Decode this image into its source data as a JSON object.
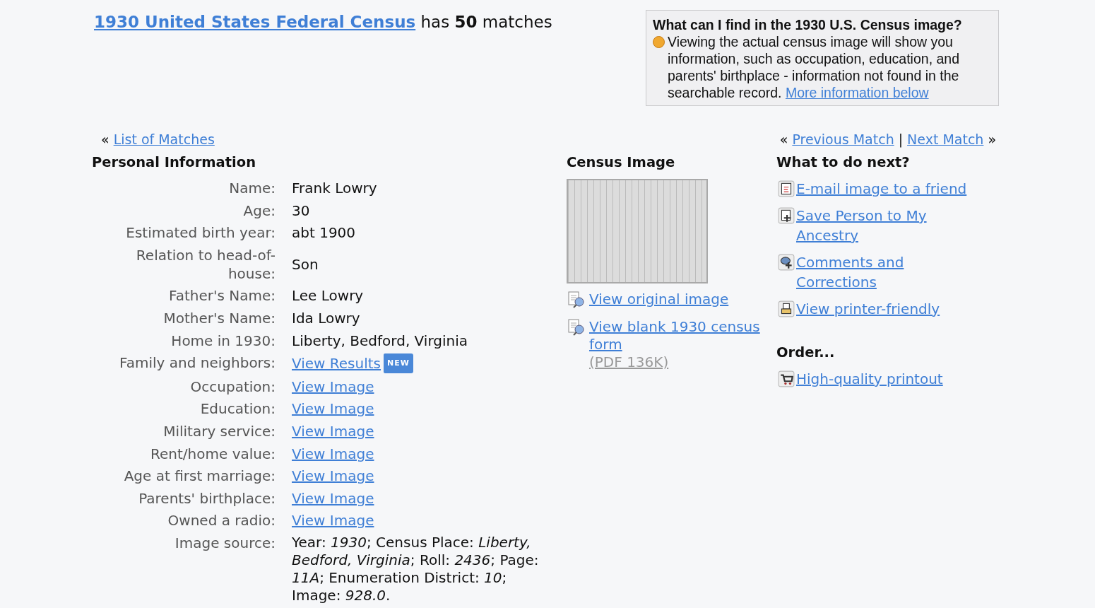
{
  "header": {
    "title_link": "1930 United States Federal Census",
    "summary": "has **50** matches"
  },
  "info_box": {
    "title": "What can I find in the 1930 U.S. Census image?",
    "body": "Viewing the actual census image will show you information, such as occupation, education, and parents' birthplace - information not found in the searchable record.",
    "link": "More information below"
  },
  "nav": {
    "back_mark": "«",
    "list_link": "List of Matches",
    "prev_mark": "«",
    "prev_link": "Previous Match",
    "separator": "|",
    "next_link": "Next Match",
    "next_mark": "»"
  },
  "personal": {
    "heading": "Personal Information",
    "fields": [
      {
        "label": "Name:",
        "value": "Frank Lowry",
        "kind": "text"
      },
      {
        "label": "Age:",
        "value": "30",
        "kind": "text"
      },
      {
        "label": "Estimated birth year:",
        "value": "abt 1900",
        "kind": "text"
      },
      {
        "label": "Relation to head-of-house:",
        "value": "Son",
        "kind": "text"
      },
      {
        "label": "Father's Name:",
        "value": "Lee Lowry",
        "kind": "text"
      },
      {
        "label": "Mother's Name:",
        "value": "Ida Lowry",
        "kind": "text"
      },
      {
        "label": "Home in 1930:",
        "value": "Liberty, Bedford, Virginia",
        "kind": "text"
      },
      {
        "label": "Family and neighbors:",
        "value": "View Results",
        "kind": "link",
        "badge": "NEW"
      },
      {
        "label": "Occupation:",
        "value": "View Image",
        "kind": "link"
      },
      {
        "label": "Education:",
        "value": "View Image",
        "kind": "link"
      },
      {
        "label": "Military service:",
        "value": "View Image",
        "kind": "link"
      },
      {
        "label": "Rent/home value:",
        "value": "View Image",
        "kind": "link"
      },
      {
        "label": "Age at first marriage:",
        "value": "View Image",
        "kind": "link"
      },
      {
        "label": "Parents' birthplace:",
        "value": "View Image",
        "kind": "link"
      },
      {
        "label": "Owned a radio:",
        "value": "View Image",
        "kind": "link"
      },
      {
        "label": "Image source:",
        "value": "Year: *1930*; Census Place: *Liberty, Bedford, Virginia*; Roll: *2436*; Page: *11A*; Enumeration District: *10*; Image: *928.0*.",
        "kind": "rich"
      }
    ]
  },
  "census_image": {
    "heading": "Census Image",
    "links": [
      {
        "text": "View original image"
      },
      {
        "text": "View blank 1930 census form",
        "note": "(PDF 136K)"
      }
    ]
  },
  "next_steps": {
    "heading": "What to do next?",
    "actions": [
      {
        "text": "E-mail image to a friend",
        "kind": "email"
      },
      {
        "text": "Save Person to My Ancestry",
        "kind": "save"
      },
      {
        "text": "Comments and Corrections",
        "kind": "comments"
      },
      {
        "text": "View printer-friendly",
        "kind": "print"
      }
    ],
    "order_heading": "Order...",
    "order_actions": [
      {
        "text": "High-quality printout",
        "kind": "cart"
      }
    ]
  }
}
